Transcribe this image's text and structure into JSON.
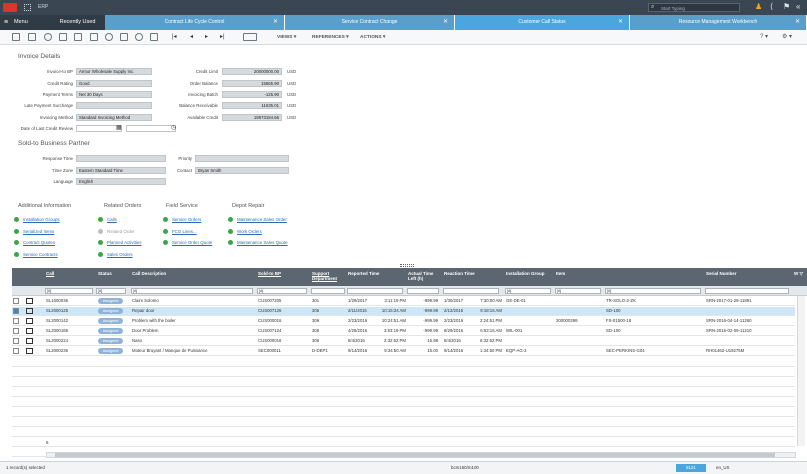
{
  "app": {
    "title": "ERP",
    "search_placeholder": "Start Typing"
  },
  "menu": {
    "label": "Menu",
    "recently_used": "Recently Used"
  },
  "tabs": [
    {
      "label": "Contract Life Cycle Control"
    },
    {
      "label": "Service Contract Change"
    },
    {
      "label": "Customer Call Status"
    },
    {
      "label": "Resource Management Workbench"
    }
  ],
  "toolbar": {
    "views": "VIEWS ▾",
    "references": "REFERENCES ▾",
    "actions": "ACTIONS ▾",
    "help": "? ▾",
    "gear": "⚙ ▾"
  },
  "invoice": {
    "title": "Invoice Details",
    "invoice_to_bp_label": "Invoice-to BP",
    "invoice_to_bp": "Armor Wholesale Supply Inc.",
    "credit_rating_label": "Credit Rating",
    "credit_rating": "Good",
    "payment_terms_label": "Payment Terms",
    "payment_terms": "Net 30 Days",
    "late_payment_label": "Late Payment Surcharge",
    "invoicing_method_label": "Invoicing Method",
    "invoicing_method": "Standard Invoicing Method",
    "last_review_label": "Date of Last Credit Review",
    "credit_limit_label": "Credit Limit",
    "credit_limit": "20000000.00",
    "order_balance_label": "Order Balance",
    "order_balance": "15665.90",
    "invoicing_batch_label": "Invoicing Batch",
    "invoicing_batch": "-125.90",
    "balance_receivable_label": "Balance Receivable",
    "balance_receivable": "11635.01",
    "available_credit_label": "Available Credit",
    "available_credit": "19973184.66",
    "currency": "USD"
  },
  "sold_to": {
    "title": "Sold-to Business Partner",
    "response_time_label": "Response Time",
    "time_zone_label": "Time Zone",
    "time_zone": "Eastern Standard Time",
    "language_label": "Language",
    "language": "English",
    "priority_label": "Priority",
    "contact_label": "Contact",
    "contact": "Bryan Smith"
  },
  "info": {
    "additional_title": "Additional Information",
    "additional": [
      "Installation Groups",
      "Serialized Items",
      "Contract Quotes",
      "Service Contracts"
    ],
    "related_title": "Related Orders",
    "related": [
      "Calls",
      "Related Order",
      "Planned Activities",
      "Sales Orders"
    ],
    "field_title": "Field Service",
    "field": [
      "Service Orders",
      "FCO Lines...",
      "Service Order Quote"
    ],
    "depot_title": "Depot Repair",
    "depot": [
      "Maintenance Sales Order",
      "Work Orders",
      "Maintenance Sales Quote"
    ]
  },
  "grid": {
    "headers": [
      "Call",
      "Status",
      "Call Description",
      "Sold-to BP",
      "Support Department",
      "Reported Time",
      "Actual Time Left (h)",
      "Reaction Time",
      "Installation Group",
      "Item",
      "Serial Number"
    ],
    "filters": [
      "[A]",
      "[A]",
      "[A]",
      "[A]",
      "",
      "",
      "",
      "[A]",
      "[A]",
      "[A]"
    ],
    "rows": [
      {
        "call": "SL1000036",
        "status": "Assigned",
        "desc": "Claim Solomo",
        "bp": "CUS007205",
        "dept": "301",
        "rtime": "1/29/2017",
        "rclock": "3:11:19 PM",
        "left": "-999.99",
        "react": "1/30/2017",
        "rclk2": "7:30:00 AM",
        "group": "GE-DE-01",
        "item": "",
        "serial": "SRN-2017-01-29-11891",
        "itemcode": "TR-SOLO-2-ZK"
      },
      {
        "call": "SL2000125",
        "status": "Assigned",
        "desc": "Repair door",
        "bp": "CUS007126",
        "dept": "306",
        "rtime": "2/11/2016",
        "rclock": "10:15:34 AM",
        "left": "-999.99",
        "react": "2/12/2016",
        "rclk2": "9:18:16 AM",
        "group": "",
        "item": "",
        "serial": "",
        "itemcode": "SD-100"
      },
      {
        "call": "SL2000142",
        "status": "Assigned",
        "desc": "Problem with the boiler",
        "bp": "CUS000016",
        "dept": "306",
        "rtime": "2/23/2016",
        "rclock": "10:24:51 AM",
        "left": "-999.99",
        "react": "2/23/2016",
        "rclk2": "2:24:51 PM",
        "group": "",
        "item": "200000299",
        "serial": "SRN-2016-04-14-11260",
        "itemcode": "FS-01500-18"
      },
      {
        "call": "SL2000168",
        "status": "Assigned",
        "desc": "Door Problem",
        "bp": "CUS007124",
        "dept": "306",
        "rtime": "4/25/2016",
        "rclock": "3:53:19 PM",
        "left": "-999.99",
        "react": "8/29/2016",
        "rclk2": "6:53:16 AM",
        "group": "WIL-001",
        "item": "",
        "serial": "SRN-2016-02-09-11210",
        "itemcode": "SD-100"
      },
      {
        "call": "SL2000224",
        "status": "Assigned",
        "desc": "Naso",
        "bp": "CUS000016",
        "dept": "306",
        "rtime": "8/4/2016",
        "rclock": "2:32:52 PM",
        "left": "15.98",
        "react": "8/4/2016",
        "rclk2": "6:32:52 PM",
        "group": "",
        "item": "",
        "serial": "",
        "itemcode": ""
      },
      {
        "call": "SL2000236",
        "status": "Assigned",
        "desc": "Moteur Bruyant / Manque de Puissance",
        "bp": "SEC000011",
        "dept": "D-DEP1",
        "rtime": "9/14/2016",
        "rclock": "9:34:50 AM",
        "left": "15.00",
        "react": "9/14/2016",
        "rclk2": "1:34:50 PM",
        "group": "EQP-AG-2",
        "item": "",
        "serial": "RH01462-U19275M",
        "itemcode": "SEC-PERKINS-G04"
      }
    ],
    "count_footer": "6"
  },
  "status": {
    "selected": "1 record(s) selected",
    "center": "bcm150/m100",
    "badge": "8121",
    "locale": "en_US"
  },
  "colors": {
    "accent": "#4aa6dd",
    "titlebar": "#3a4752",
    "grid_header": "#5b6670",
    "ok": "#3aa64a"
  }
}
